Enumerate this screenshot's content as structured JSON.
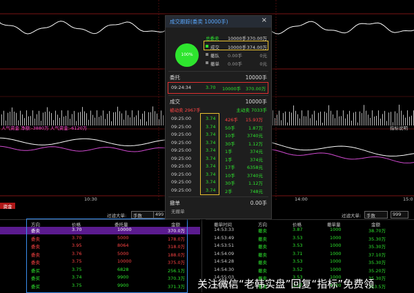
{
  "popup": {
    "title": "成交跟踪(委卖 10000手)",
    "close": "×",
    "donut_pct": "100%",
    "summary": [
      {
        "label": "总委卖",
        "value": "10000手",
        "amount": "370.00万",
        "color": "#2ee52e"
      },
      {
        "label": "成交",
        "value": "10000手",
        "amount": "374.00万",
        "color": "#2ee52e"
      },
      {
        "label": "撤队",
        "value": "0.00手",
        "amount": "0元",
        "color": "#888888"
      },
      {
        "label": "撤单",
        "value": "0.00手",
        "amount": "0元",
        "color": "#888888"
      }
    ],
    "order_title": "委托",
    "order_total": "10000手",
    "order": {
      "time": "09:24:34",
      "price": "3.70",
      "vol": "10000手",
      "amt": "370.00万"
    },
    "deal_title": "成交",
    "deal_total": "10000手",
    "passive": "被动卖 2967手",
    "active": "主动卖 7033手",
    "trades": [
      {
        "time": "09:25:00",
        "price": "3.74",
        "vol": "426手",
        "amt": "15.93万"
      },
      {
        "time": "09:25:00",
        "price": "3.74",
        "vol": "50手",
        "amt": "1.87万"
      },
      {
        "time": "09:25:00",
        "price": "3.74",
        "vol": "10手",
        "amt": "3740元"
      },
      {
        "time": "09:25:00",
        "price": "3.74",
        "vol": "30手",
        "amt": "1.12万"
      },
      {
        "time": "09:25:00",
        "price": "3.74",
        "vol": "1手",
        "amt": "374元"
      },
      {
        "time": "09:25:00",
        "price": "3.74",
        "vol": "1手",
        "amt": "374元"
      },
      {
        "time": "09:25:00",
        "price": "3.74",
        "vol": "17手",
        "amt": "6358元"
      },
      {
        "time": "09:25:00",
        "price": "3.74",
        "vol": "10手",
        "amt": "3740元"
      },
      {
        "time": "09:25:00",
        "price": "3.74",
        "vol": "30手",
        "amt": "1.12万"
      },
      {
        "time": "09:25:00",
        "price": "3.74",
        "vol": "2手",
        "amt": "748元"
      }
    ],
    "cancel_title": "撤单",
    "cancel_value": "0.00手",
    "cancel_none": "无撤单"
  },
  "chart": {
    "label_left": "人气资金 净额:-3880万 人气资金:-6120万",
    "label_right": "指标说明",
    "time_1": "10:30",
    "time_2": "14:00",
    "time_3": "15:0",
    "tag_left": "资金"
  },
  "left_table": {
    "filter_label": "过滤大单:",
    "filter_value": "手数",
    "filter_num": "499",
    "headers": [
      "方向",
      "价格",
      "委托量",
      "金额"
    ],
    "rows": [
      {
        "dir": "委卖",
        "price": "3.70",
        "vol": "10000",
        "amt": "370.0万",
        "highlight": true
      },
      {
        "dir": "委卖",
        "price": "3.70",
        "vol": "5000",
        "amt": "178.0万"
      },
      {
        "dir": "委卖",
        "price": "3.95",
        "vol": "8064",
        "amt": "318.0万"
      },
      {
        "dir": "委卖",
        "price": "3.76",
        "vol": "5000",
        "amt": "188.0万"
      },
      {
        "dir": "委卖",
        "price": "3.75",
        "vol": "10000",
        "amt": "375.0万"
      },
      {
        "dir": "委买",
        "price": "3.75",
        "vol": "6828",
        "amt": "256.1万"
      },
      {
        "dir": "委买",
        "price": "3.74",
        "vol": "9900",
        "amt": "370.3万"
      },
      {
        "dir": "委买",
        "price": "3.75",
        "vol": "9900",
        "amt": "371.3万"
      }
    ]
  },
  "right_table": {
    "filter_label": "过滤大单:",
    "filter_value": "手数",
    "filter_num": "999",
    "headers": [
      "撤单时间",
      "方向",
      "价格",
      "撤单量",
      "金额"
    ],
    "rows": [
      {
        "time": "14:53:33",
        "dir": "撤卖",
        "price": "3.87",
        "vol": "1000",
        "amt": "38.70万"
      },
      {
        "time": "14:53:49",
        "dir": "撤卖",
        "price": "3.53",
        "vol": "1000",
        "amt": "35.30万"
      },
      {
        "time": "14:53:51",
        "dir": "撤卖",
        "price": "3.53",
        "vol": "1000",
        "amt": "35.30万"
      },
      {
        "time": "14:54:09",
        "dir": "撤卖",
        "price": "3.71",
        "vol": "1000",
        "amt": "37.10万"
      },
      {
        "time": "14:54:28",
        "dir": "撤卖",
        "price": "3.53",
        "vol": "1000",
        "amt": "35.30万"
      },
      {
        "time": "14:54:30",
        "dir": "撤卖",
        "price": "3.52",
        "vol": "1000",
        "amt": "35.20万"
      },
      {
        "time": "14:55:03",
        "dir": "撤卖",
        "price": "3.53",
        "vol": "1000",
        "amt": "35.30万"
      },
      {
        "time": "14:55:10",
        "dir": "撤卖",
        "price": "3.57",
        "vol": "4300",
        "amt": "153.5万"
      }
    ]
  },
  "watermark": "关注微信“老韩实盘”回复“指标”免费领",
  "colors": {
    "up": "#ff4444",
    "down": "#2ee52e",
    "highlight": "#5b1b8f",
    "box_red": "#e03030",
    "box_yellow": "#e8c030",
    "box_blue": "#3a8ef0"
  }
}
